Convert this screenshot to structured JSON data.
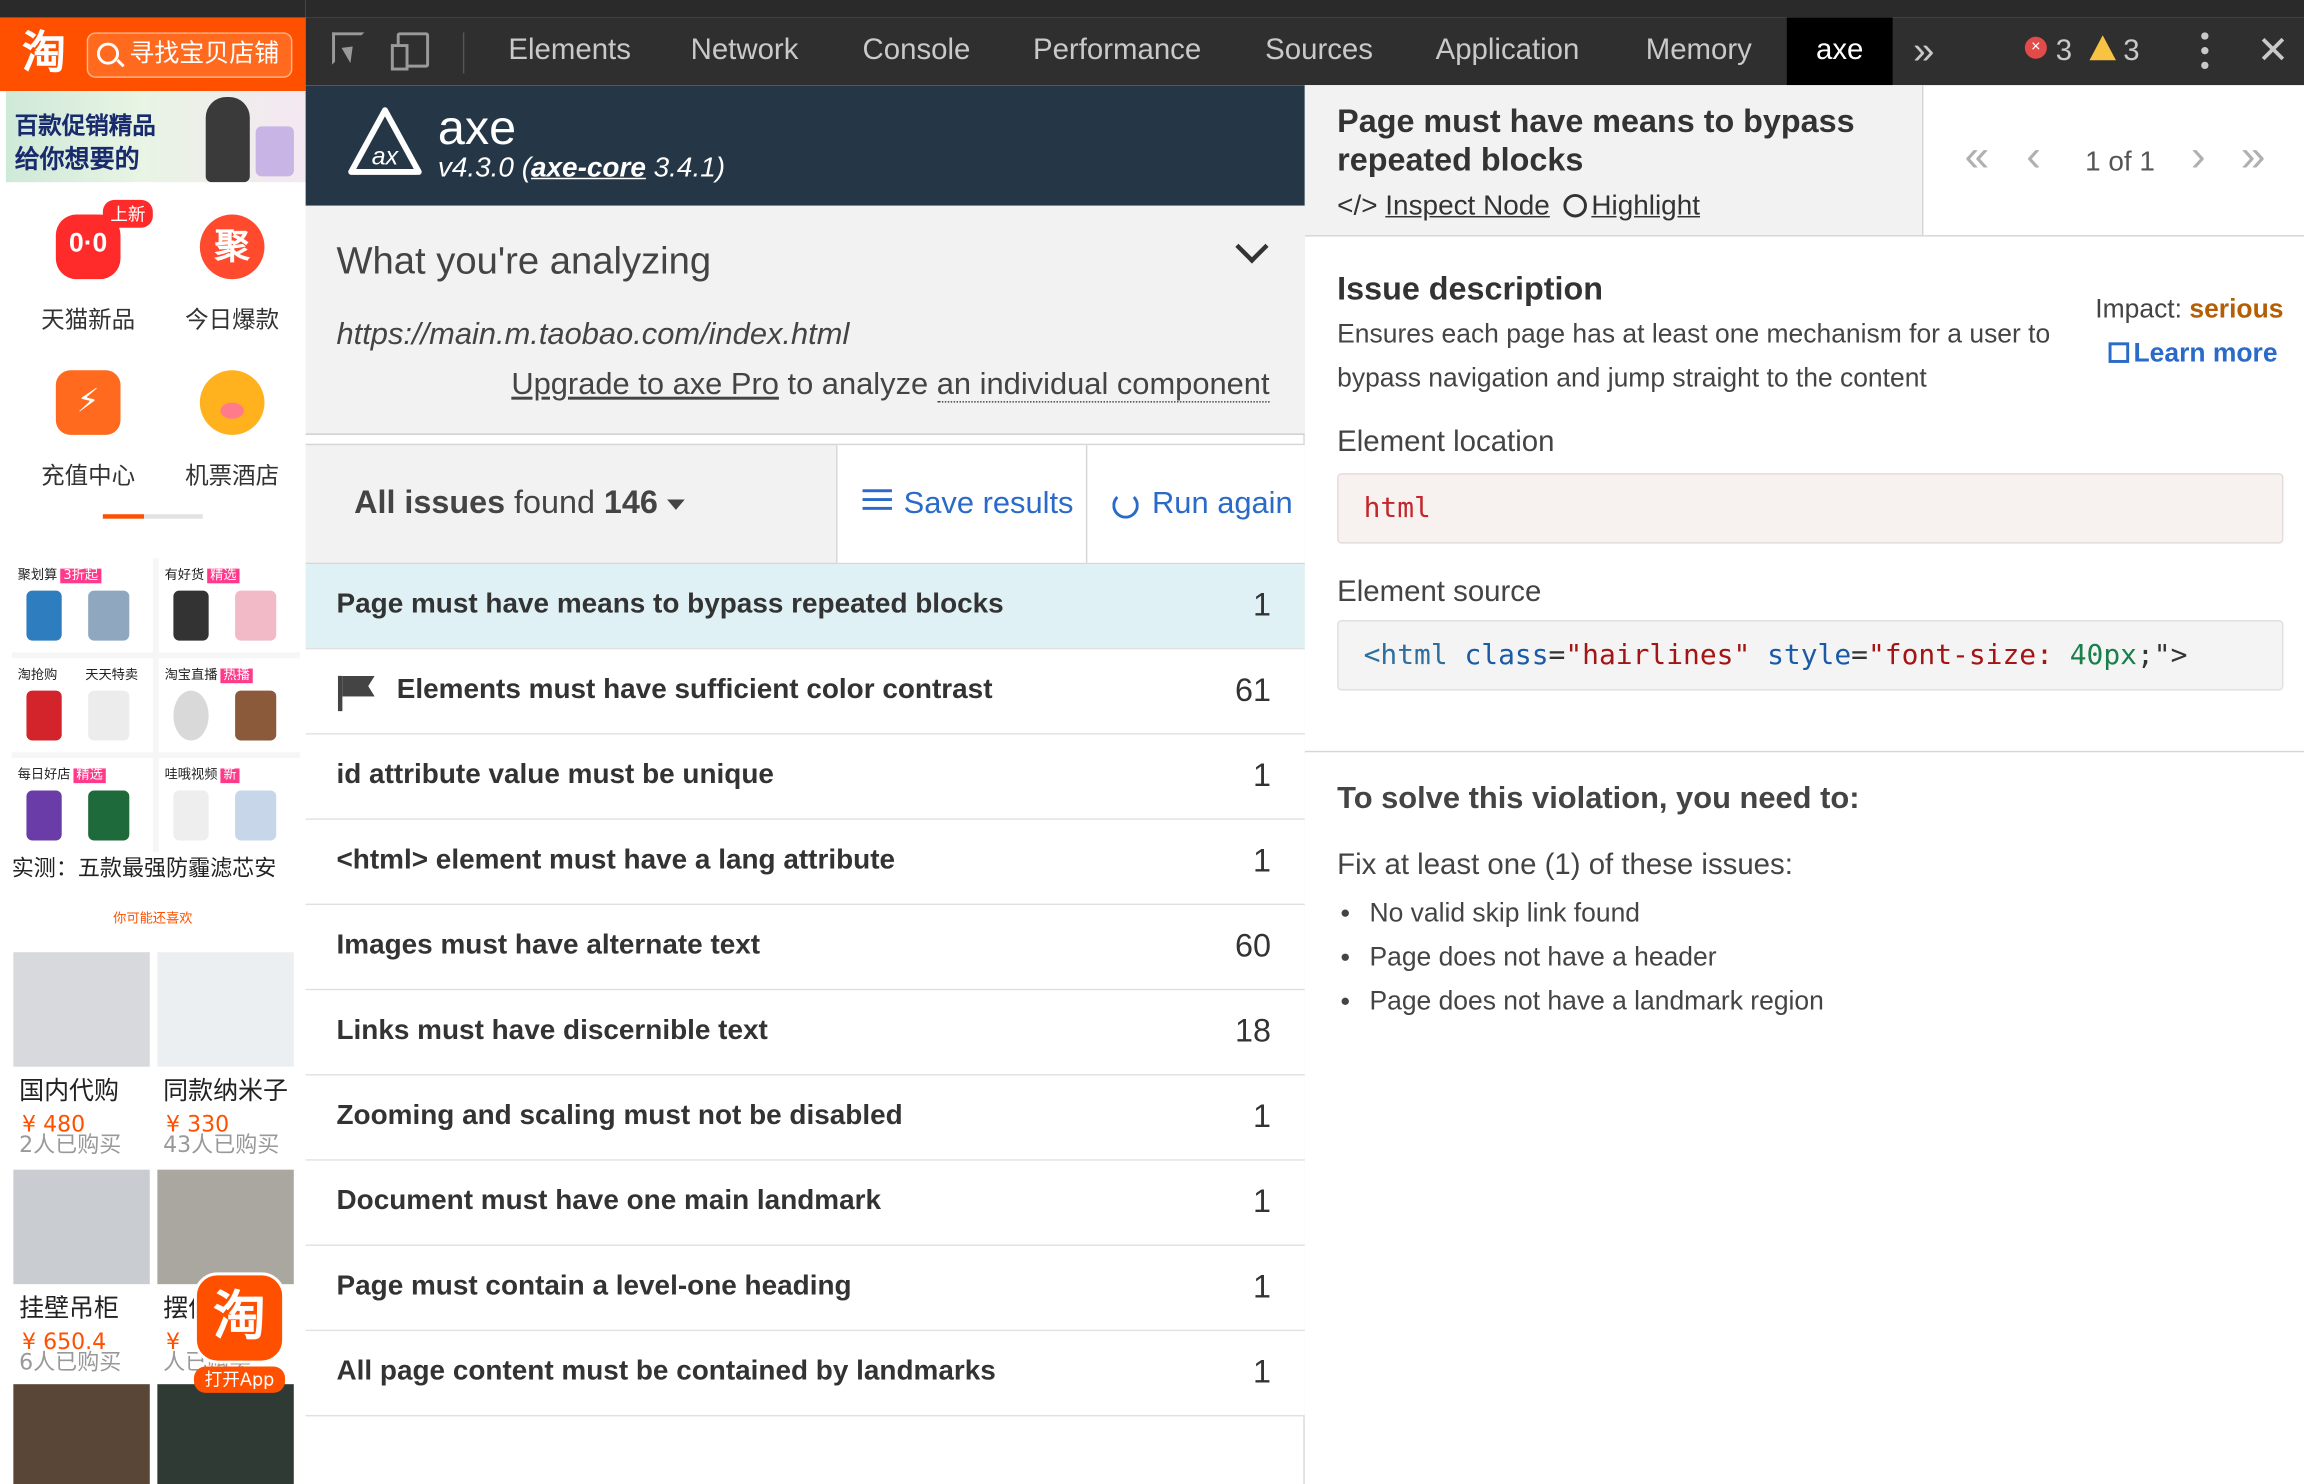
{
  "taobao": {
    "logo": "淘",
    "search_placeholder": "寻找宝贝店铺",
    "banner_line1": "百款促销精品",
    "banner_line2": "给你想要的",
    "badge_new": "上新",
    "icons": [
      {
        "label": "天猫新品",
        "glyph": ""
      },
      {
        "label": "今日爆款",
        "glyph": "聚"
      },
      {
        "label": "充值中心",
        "glyph": ""
      },
      {
        "label": "机票酒店",
        "glyph": ""
      }
    ],
    "grid": [
      {
        "title": "聚划算",
        "tag": "3折起"
      },
      {
        "title": "有好货",
        "tag": "精选"
      },
      {
        "title": "淘抢购",
        "tag": ""
      },
      {
        "title": "天天特卖",
        "tag": ""
      },
      {
        "title": "淘宝直播",
        "tag": "热播"
      },
      {
        "title": "",
        "tag": ""
      },
      {
        "title": "每日好店",
        "tag": "精选"
      },
      {
        "title": "哇哦视频",
        "tag": "新"
      }
    ],
    "grid_caption": "实测：五款最强防霾滤芯安",
    "like_label": "你可能还喜欢",
    "products": [
      {
        "name": "国内代购",
        "price": "¥ 480",
        "sold": "2人已购买",
        "color": "#d7d9dc"
      },
      {
        "name": "同款纳米子",
        "price": "¥ 330",
        "sold": "43人已购买",
        "color": "#eceff2"
      },
      {
        "name": "挂壁吊柜",
        "price": "¥ 650.4",
        "sold": "6人已购买",
        "color": "#c9cdd2"
      },
      {
        "name": "摆件",
        "price": "¥",
        "sold": "人已购买",
        "color": "#a9a7a0"
      },
      {
        "name": "",
        "price": "",
        "sold": "",
        "color": "#5a4636"
      },
      {
        "name": "",
        "price": "",
        "sold": "",
        "color": "#2f3a34"
      }
    ],
    "float_logo": "淘",
    "float_label": "打开App"
  },
  "devtools": {
    "tabs": [
      "Elements",
      "Network",
      "Console",
      "Performance",
      "Sources",
      "Application",
      "Memory",
      "axe"
    ],
    "more": "»",
    "errors": "3",
    "warnings": "3",
    "close": "✕"
  },
  "axe": {
    "title": "axe",
    "version_prefix": "v4.3.0 (",
    "core_link": "axe-core",
    "core_version": " 3.4.1)",
    "analyzing_title": "What you're analyzing",
    "url": "https://main.m.taobao.com/index.html",
    "upgrade_link": "Upgrade to axe Pro",
    "upgrade_mid": " to analyze ",
    "upgrade_tail": "an individual component",
    "issues_label": "All issues",
    "issues_found": " found ",
    "issues_count": "146",
    "save_label": "Save results",
    "run_label": "Run again",
    "issues": [
      {
        "title": "Page must have means to bypass repeated blocks",
        "count": "1",
        "selected": true,
        "flag": false
      },
      {
        "title": "Elements must have sufficient color contrast",
        "count": "61",
        "selected": false,
        "flag": true
      },
      {
        "title": "id attribute value must be unique",
        "count": "1",
        "selected": false,
        "flag": false
      },
      {
        "title": "<html> element must have a lang attribute",
        "count": "1",
        "selected": false,
        "flag": false
      },
      {
        "title": "Images must have alternate text",
        "count": "60",
        "selected": false,
        "flag": false
      },
      {
        "title": "Links must have discernible text",
        "count": "18",
        "selected": false,
        "flag": false
      },
      {
        "title": "Zooming and scaling must not be disabled",
        "count": "1",
        "selected": false,
        "flag": false
      },
      {
        "title": "Document must have one main landmark",
        "count": "1",
        "selected": false,
        "flag": false
      },
      {
        "title": "Page must contain a level-one heading",
        "count": "1",
        "selected": false,
        "flag": false
      },
      {
        "title": "All page content must be contained by landmarks",
        "count": "1",
        "selected": false,
        "flag": false
      }
    ]
  },
  "detail": {
    "title": "Page must have means to bypass repeated blocks",
    "inspect_label": "Inspect Node",
    "highlight_label": "Highlight",
    "nav_count": "1 of 1",
    "desc_heading": "Issue description",
    "desc_text": "Ensures each page has at least one mechanism for a user to bypass navigation and jump straight to the content",
    "impact_label": "Impact: ",
    "impact_value": "serious",
    "learn_more": "Learn more",
    "location_heading": "Element location",
    "location_value": "html",
    "source_heading": "Element source",
    "source_tag_open": "<html",
    "source_attr1": "class",
    "source_val1": "\"hairlines\"",
    "source_attr2": "style",
    "source_val2": "\"font-size:",
    "source_num": "40px",
    "source_end": ";\">",
    "solve_heading": "To solve this violation, you need to:",
    "solve_sub": "Fix at least one (1) of these issues:",
    "solve_items": [
      "No valid skip link found",
      "Page does not have a header",
      "Page does not have a landmark region"
    ]
  }
}
